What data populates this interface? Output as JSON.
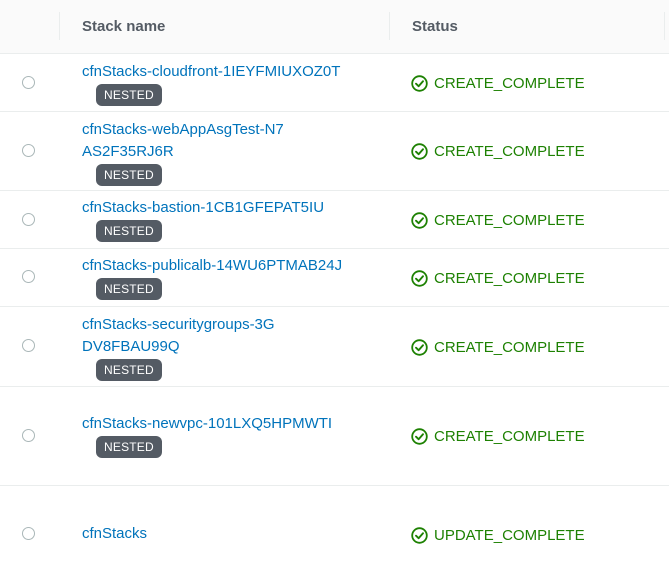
{
  "table": {
    "columns": {
      "name": "Stack name",
      "status": "Status"
    },
    "rows": [
      {
        "name": "cfnStacks-cloudfront-1IEYFMIUXOZ0T",
        "badge": "NESTED",
        "status": "CREATE_COMPLETE"
      },
      {
        "name": "cfnStacks-webAppAsgTest-N7AS2F35RJ6R",
        "badge": "NESTED",
        "status": "CREATE_COMPLETE"
      },
      {
        "name": "cfnStacks-bastion-1CB1GFEPAT5IU",
        "badge": "NESTED",
        "status": "CREATE_COMPLETE"
      },
      {
        "name": "cfnStacks-publicalb-14WU6PTMAB24J",
        "badge": "NESTED",
        "status": "CREATE_COMPLETE"
      },
      {
        "name": "cfnStacks-securitygroups-3GDV8FBAU99Q",
        "badge": "NESTED",
        "status": "CREATE_COMPLETE"
      },
      {
        "name": "cfnStacks-newvpc-101LXQ5HPMWTI",
        "badge": "NESTED",
        "status": "CREATE_COMPLETE"
      },
      {
        "name": "cfnStacks",
        "status": "UPDATE_COMPLETE"
      }
    ]
  },
  "colors": {
    "link": "#0073bb",
    "success": "#1d8102",
    "badge": "#545b64"
  },
  "icons": {
    "status": "check-circle-icon",
    "select": "radio-button"
  }
}
